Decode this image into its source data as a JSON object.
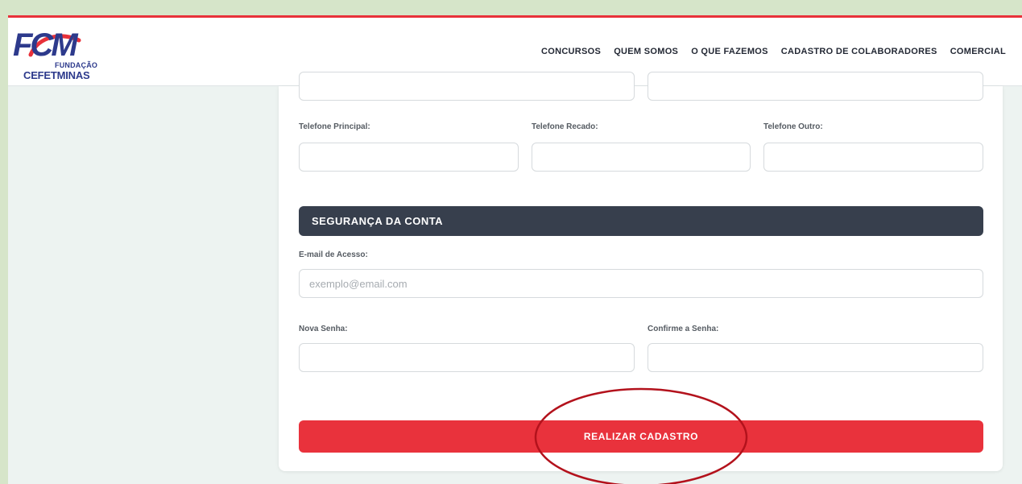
{
  "brand": {
    "logo_letters": "FCM",
    "logo_line1": "FUNDAÇÃO",
    "logo_line2": "CEFETMINAS",
    "primary_color": "#2d3a8c",
    "accent_color": "#e8313a"
  },
  "nav": {
    "items": [
      {
        "label": "CONCURSOS"
      },
      {
        "label": "QUEM SOMOS"
      },
      {
        "label": "O QUE FAZEMOS"
      },
      {
        "label": "CADASTRO DE COLABORADORES"
      },
      {
        "label": "COMERCIAL"
      }
    ]
  },
  "form": {
    "phones": {
      "principal_label": "Telefone Principal:",
      "principal_value": "",
      "recado_label": "Telefone Recado:",
      "recado_value": "",
      "outro_label": "Telefone Outro:",
      "outro_value": ""
    },
    "security": {
      "title": "SEGURANÇA DA CONTA",
      "email_label": "E-mail de Acesso:",
      "email_placeholder": "exemplo@email.com",
      "email_value": "",
      "new_password_label": "Nova Senha:",
      "confirm_password_label": "Confirme a Senha:"
    },
    "submit_label": "REALIZAR CADASTRO"
  },
  "colors": {
    "section_bar": "#373f4d",
    "submit_button": "#e9323c",
    "annotation_circle": "#b3121c"
  }
}
